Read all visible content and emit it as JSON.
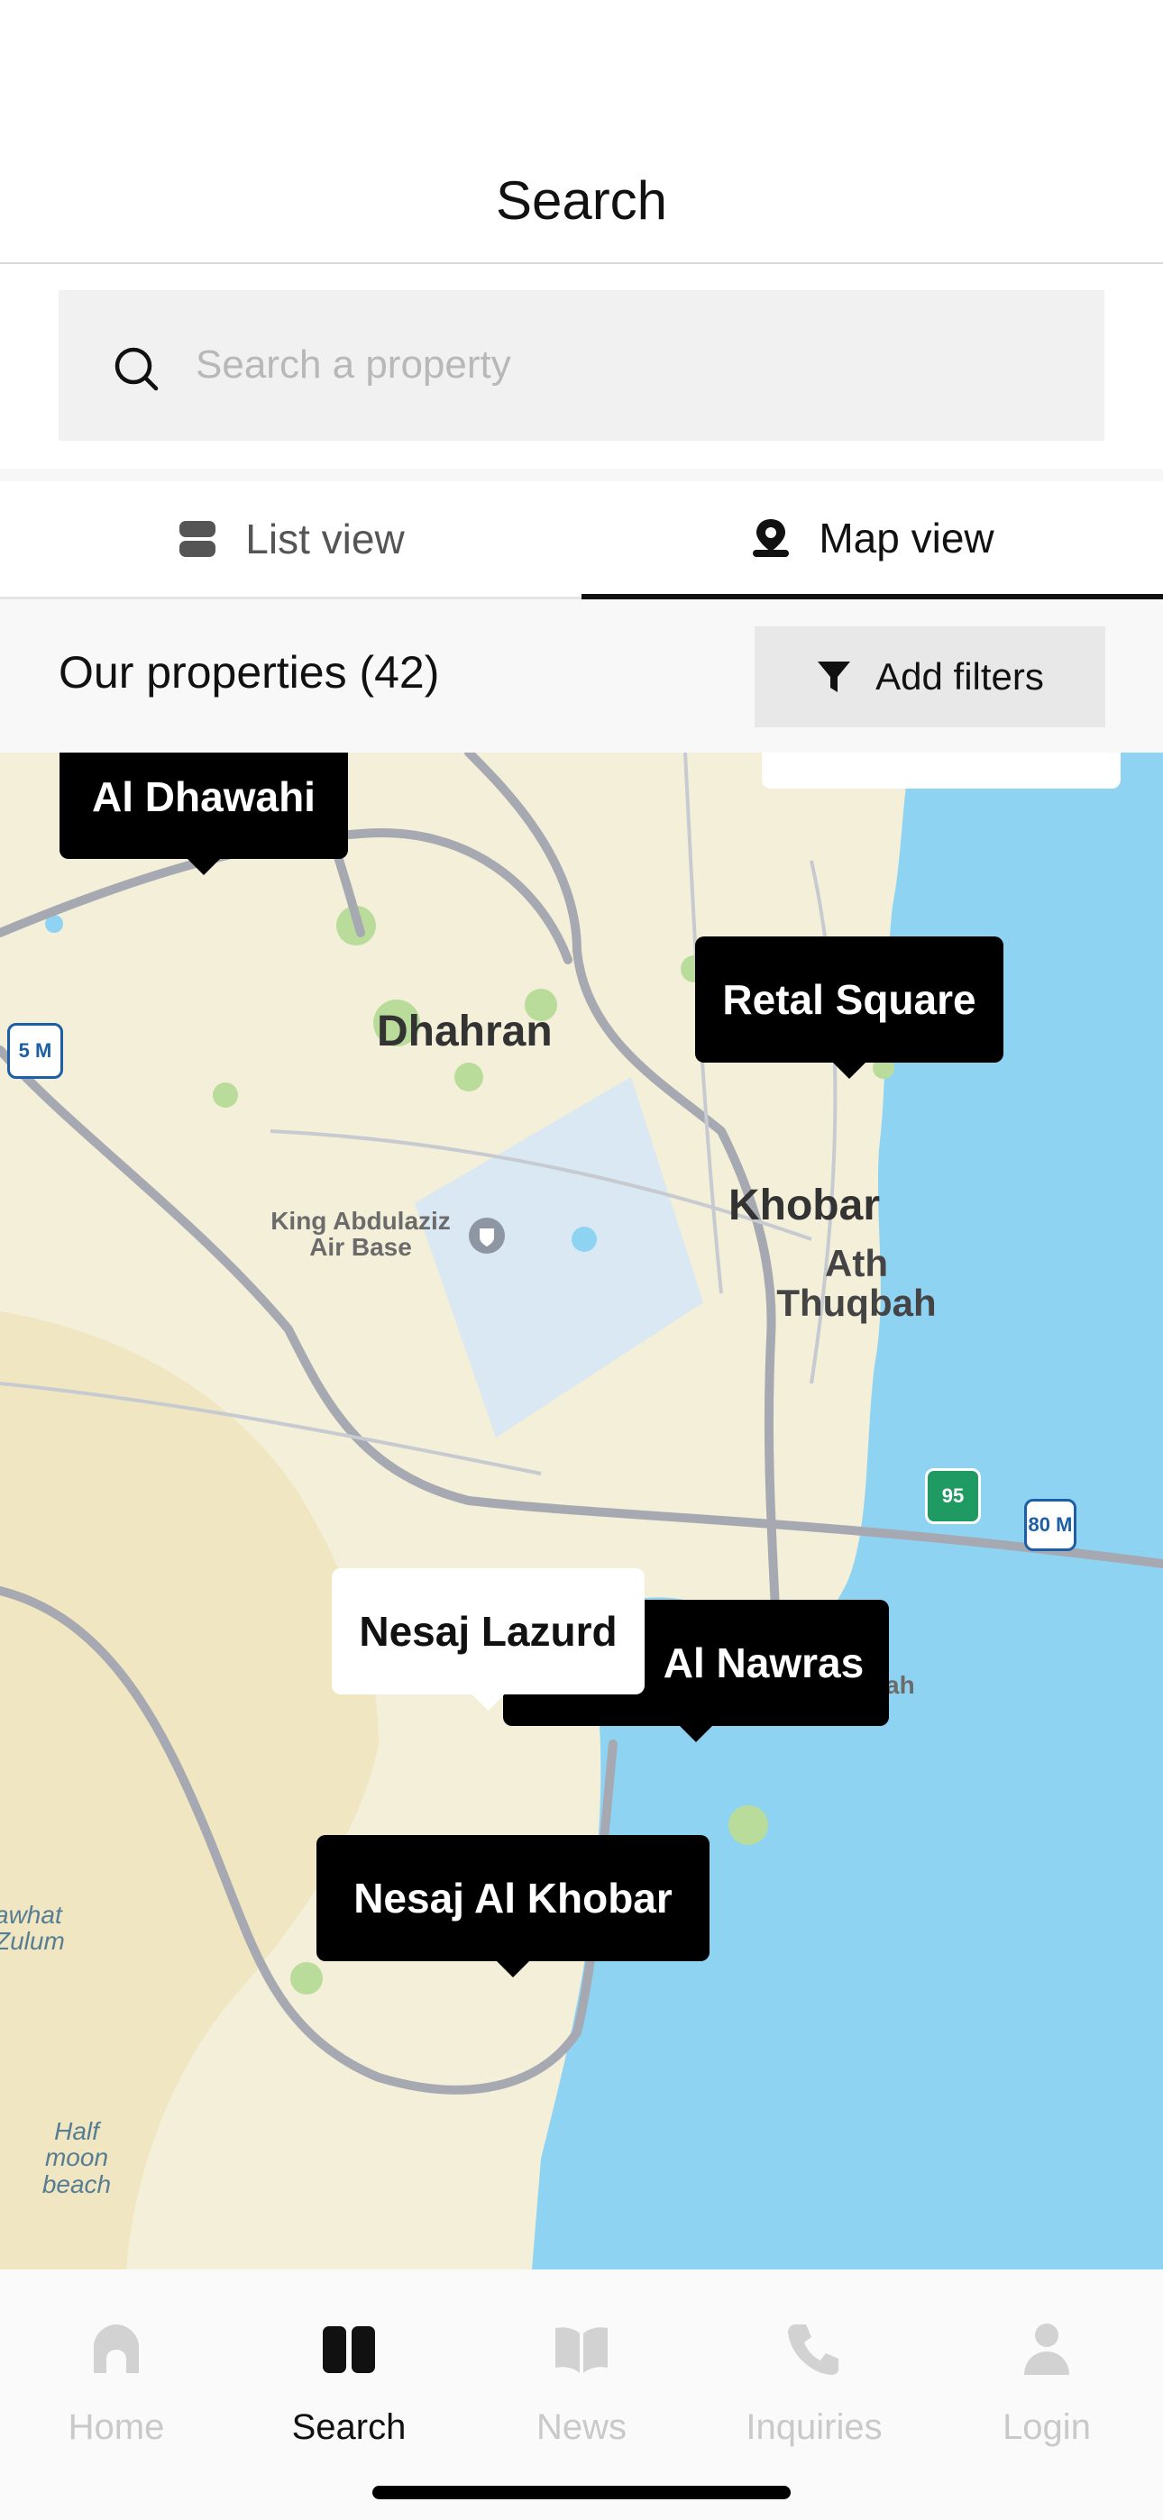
{
  "header": {
    "title": "Search"
  },
  "search": {
    "placeholder": "Search a property"
  },
  "view_tabs": [
    {
      "label": "List view",
      "icon": "list-view-icon",
      "active": false
    },
    {
      "label": "Map view",
      "icon": "map-pin-icon",
      "active": true
    }
  ],
  "properties": {
    "title": "Our properties (42)",
    "filter_label": "Add filters"
  },
  "map": {
    "place_labels": [
      "Dhahran",
      "Khobar",
      "Ath Thuqbah",
      "King Abdulaziz Air Base",
      "awhat Zulum",
      "Half moon beach",
      "ah"
    ],
    "road_shields": [
      "5 M",
      "95",
      "80 M"
    ],
    "pins": [
      {
        "label": "Al Dhawahi",
        "style": "dark"
      },
      {
        "label": "Retal Square",
        "style": "dark"
      },
      {
        "label": "Al Nawras",
        "style": "dark"
      },
      {
        "label": "Nesaj Lazurd",
        "style": "light"
      },
      {
        "label": "Nesaj Al Khobar",
        "style": "dark"
      }
    ]
  },
  "nav": [
    {
      "label": "Home",
      "icon": "home-icon",
      "active": false
    },
    {
      "label": "Search",
      "icon": "search-book-icon",
      "active": true
    },
    {
      "label": "News",
      "icon": "news-icon",
      "active": false
    },
    {
      "label": "Inquiries",
      "icon": "phone-icon",
      "active": false
    },
    {
      "label": "Login",
      "icon": "user-icon",
      "active": false
    }
  ],
  "colors": {
    "accent": "#000000",
    "map_water": "#8fd3f2",
    "map_land": "#f3efd8",
    "inactive_nav": "#c9c9c9"
  }
}
